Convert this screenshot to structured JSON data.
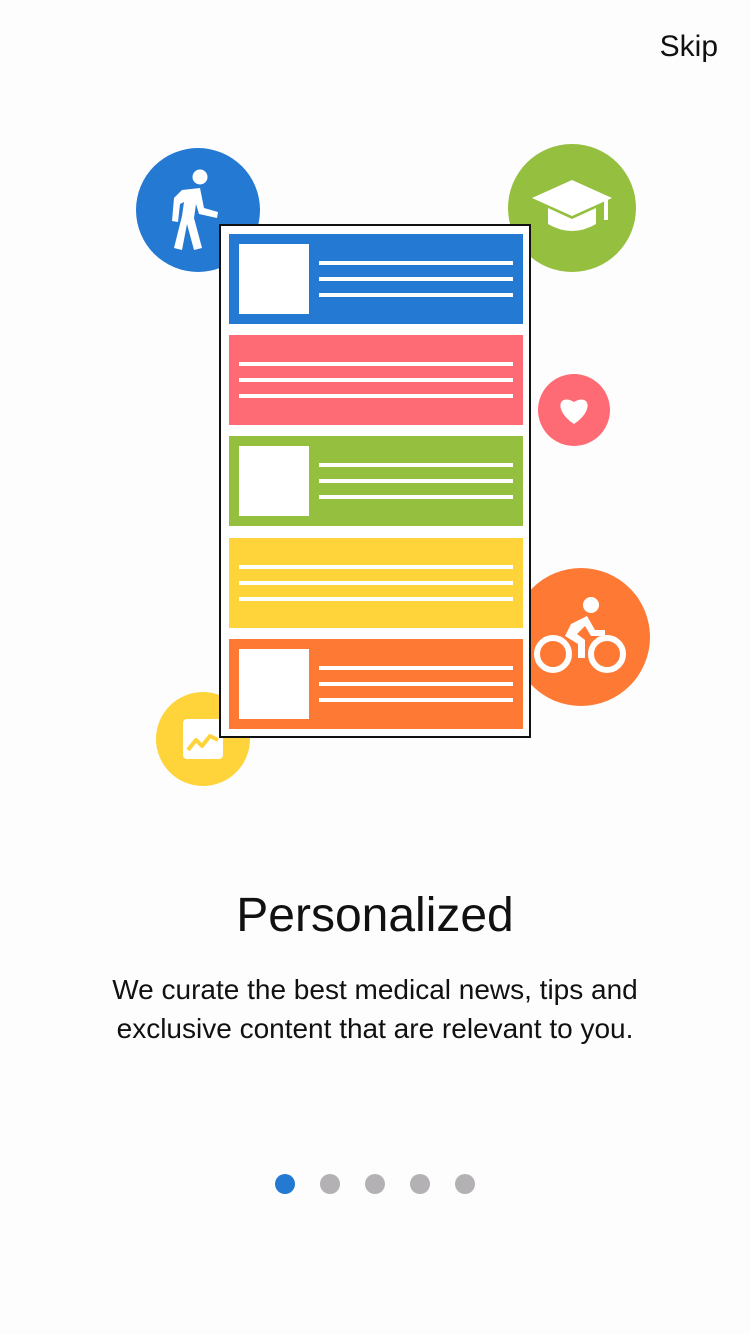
{
  "header": {
    "skip_label": "Skip"
  },
  "illustration": {
    "icons": [
      {
        "name": "walking-person-icon",
        "color": "#2479d3"
      },
      {
        "name": "graduation-cap-icon",
        "color": "#95bf3f"
      },
      {
        "name": "heart-icon",
        "color": "#fe6b74"
      },
      {
        "name": "bicycle-icon",
        "color": "#fe7a34"
      },
      {
        "name": "chart-icon",
        "color": "#fed43a"
      }
    ],
    "cards": [
      {
        "color": "#2479d3",
        "has_thumbnail": true
      },
      {
        "color": "#fe6b74",
        "has_thumbnail": false
      },
      {
        "color": "#95bf3f",
        "has_thumbnail": true
      },
      {
        "color": "#fed43a",
        "has_thumbnail": false
      },
      {
        "color": "#fe7a34",
        "has_thumbnail": true
      }
    ]
  },
  "content": {
    "title": "Personalized",
    "description_line1": "We curate the best medical news, tips and",
    "description_line2": "exclusive content that are relevant to you."
  },
  "pager": {
    "total": 5,
    "current": 1,
    "active_color": "#2479d3",
    "inactive_color": "#b3b1b3"
  }
}
